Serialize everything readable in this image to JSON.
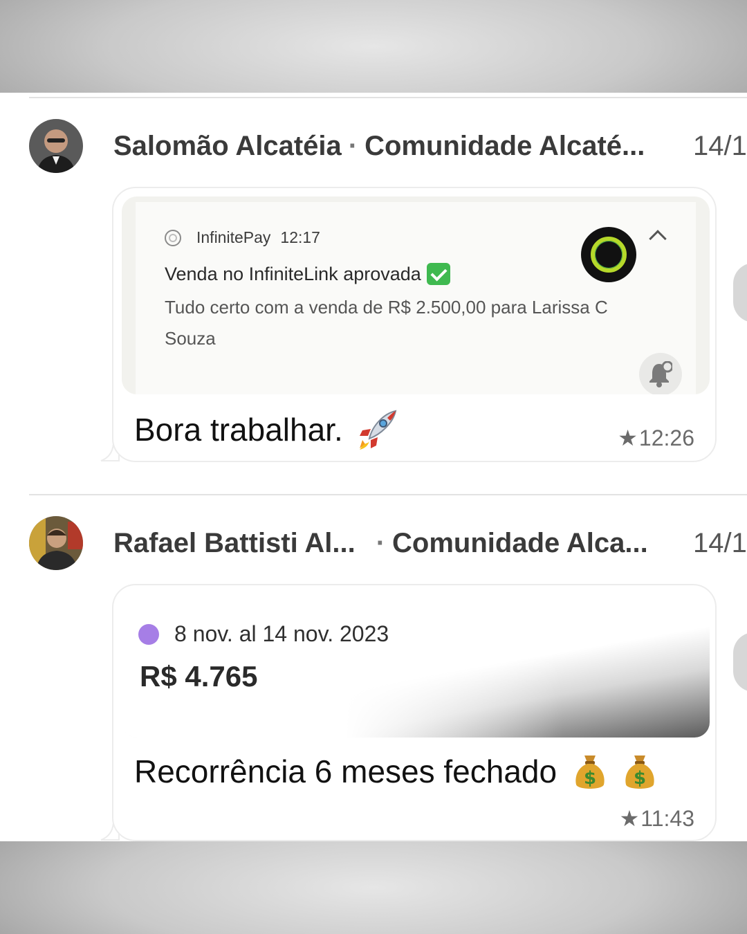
{
  "messages": [
    {
      "author": "Salomão Alcatéia",
      "group": "Comunidade Alcaté...",
      "date": "14/1",
      "notification": {
        "app": "InfinitePay",
        "time": "12:17",
        "title": "Venda no InfiniteLink aprovada",
        "body": "Tudo certo com a venda de R$ 2.500,00 para Larissa C Souza"
      },
      "text": "Bora trabalhar.",
      "timestamp": "12:26",
      "starred": true
    },
    {
      "author": "Rafael Battisti Al...",
      "group": "Comunidade Alca...",
      "date": "14/1",
      "card": {
        "range": "8 nov. al 14 nov. 2023",
        "amount": "R$ 4.765"
      },
      "text": "Recorrência 6 meses fechado",
      "timestamp": "11:43",
      "starred": true
    }
  ],
  "separator": "·",
  "star_glyph": "★",
  "icons": [
    "avatar",
    "infinitepay-icon",
    "check-emoji-icon",
    "ring-app-icon",
    "chevron-up-icon",
    "bell-snooze-icon",
    "rocket-emoji-icon",
    "money-bag-emoji-icon",
    "star-icon"
  ],
  "colors": {
    "dot": "#a67ee6",
    "check": "#3fb950",
    "ring": "#b6d92a"
  }
}
